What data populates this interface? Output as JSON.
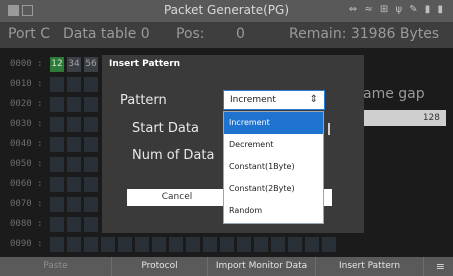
{
  "titlebar": {
    "title": "Packet Generate(PG)",
    "status_icons": "⇔ ≈ ⊞ ψ ✎ ▮ ▮"
  },
  "info": {
    "port": "Port C",
    "table": "Data table 0",
    "pos_label": "Pos:",
    "pos_value": "0",
    "remain": "Remain: 31986 Bytes"
  },
  "grid": {
    "rows": [
      "0000 :",
      "0010 :",
      "0020 :",
      "0030 :",
      "0040 :",
      "0050 :",
      "0060 :",
      "0070 :",
      "0080 :",
      "0090 :"
    ],
    "first_cells": [
      "12",
      "34",
      "56"
    ]
  },
  "frame_gap": {
    "label": "ame gap",
    "value": "128"
  },
  "dialog": {
    "title": "Insert Pattern",
    "pattern_label": "Pattern",
    "pattern_value": "Increment",
    "start_label": "Start Data",
    "num_label": "Num of Data",
    "cancel_label": "Cancel"
  },
  "dropdown": {
    "options": [
      "Increment",
      "Decrement",
      "Constant(1Byte)",
      "Constant(2Byte)",
      "Random"
    ],
    "selected_index": 0
  },
  "bottom": {
    "tabs": [
      "Paste",
      "Protocol",
      "Import Monitor Data",
      "Insert Pattern"
    ]
  },
  "colors": {
    "accent": "#1e73cf",
    "cell_active": "#2d7a3a"
  }
}
